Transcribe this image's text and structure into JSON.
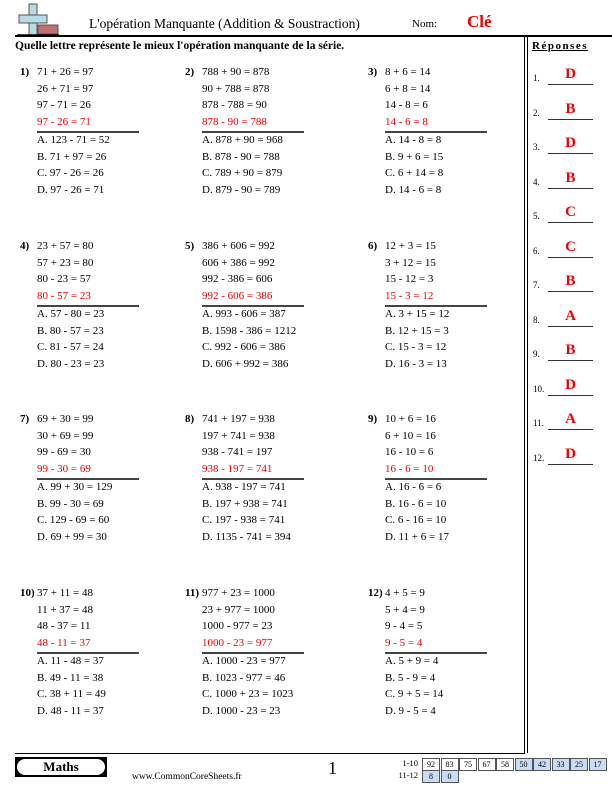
{
  "header": {
    "logo_icon": "plus-minus-icon",
    "title": "L'opération Manquante (Addition & Soustraction)",
    "nom_label": "Nom:",
    "nom_value": "Clé",
    "instruction": "Quelle lettre représente le mieux l'opération manquante de la série."
  },
  "answers": {
    "heading": "Réponses",
    "items": [
      {
        "num": "1.",
        "letter": "D"
      },
      {
        "num": "2.",
        "letter": "B"
      },
      {
        "num": "3.",
        "letter": "D"
      },
      {
        "num": "4.",
        "letter": "B"
      },
      {
        "num": "5.",
        "letter": "C"
      },
      {
        "num": "6.",
        "letter": "C"
      },
      {
        "num": "7.",
        "letter": "B"
      },
      {
        "num": "8.",
        "letter": "A"
      },
      {
        "num": "9.",
        "letter": "B"
      },
      {
        "num": "10.",
        "letter": "D"
      },
      {
        "num": "11.",
        "letter": "A"
      },
      {
        "num": "12.",
        "letter": "D"
      }
    ]
  },
  "problems": [
    {
      "num": "1)",
      "given": [
        "71 + 26 = 97",
        "26 + 71 = 97",
        "97 - 71 = 26"
      ],
      "missing": "97 - 26 = 71",
      "options": [
        "A. 123 - 71 = 52",
        "B. 71 + 97 = 26",
        "C. 97 - 26 = 26",
        "D. 97 - 26 = 71"
      ]
    },
    {
      "num": "2)",
      "given": [
        "788 + 90 = 878",
        "90 + 788 = 878",
        "878 - 788 = 90"
      ],
      "missing": "878 - 90 = 788",
      "options": [
        "A. 878 + 90 = 968",
        "B. 878 - 90 = 788",
        "C. 789 + 90 = 879",
        "D. 879 - 90 = 789"
      ]
    },
    {
      "num": "3)",
      "given": [
        "8 + 6 = 14",
        "6 + 8 = 14",
        "14 - 8 = 6"
      ],
      "missing": "14 - 6 = 8",
      "options": [
        "A. 14 - 8 = 8",
        "B. 9 + 6 = 15",
        "C. 6 + 14 = 8",
        "D. 14 - 6 = 8"
      ]
    },
    {
      "num": "4)",
      "given": [
        "23 + 57 = 80",
        "57 + 23 = 80",
        "80 - 23 = 57"
      ],
      "missing": "80 - 57 = 23",
      "options": [
        "A. 57 - 80 = 23",
        "B. 80 - 57 = 23",
        "C. 81 - 57 = 24",
        "D. 80 - 23 = 23"
      ]
    },
    {
      "num": "5)",
      "given": [
        "386 + 606 = 992",
        "606 + 386 = 992",
        "992 - 386 = 606"
      ],
      "missing": "992 - 606 = 386",
      "options": [
        "A. 993 - 606 = 387",
        "B. 1598 - 386 = 1212",
        "C. 992 - 606 = 386",
        "D. 606 + 992 = 386"
      ]
    },
    {
      "num": "6)",
      "given": [
        "12 + 3 = 15",
        "3 + 12 = 15",
        "15 - 12 = 3"
      ],
      "missing": "15 - 3 = 12",
      "options": [
        "A. 3 + 15 = 12",
        "B. 12 + 15 = 3",
        "C. 15 - 3 = 12",
        "D. 16 - 3 = 13"
      ]
    },
    {
      "num": "7)",
      "given": [
        "69 + 30 = 99",
        "30 + 69 = 99",
        "99 - 69 = 30"
      ],
      "missing": "99 - 30 = 69",
      "options": [
        "A. 99 + 30 = 129",
        "B. 99 - 30 = 69",
        "C. 129 - 69 = 60",
        "D. 69 + 99 = 30"
      ]
    },
    {
      "num": "8)",
      "given": [
        "741 + 197 = 938",
        "197 + 741 = 938",
        "938 - 741 = 197"
      ],
      "missing": "938 - 197 = 741",
      "options": [
        "A. 938 - 197 = 741",
        "B. 197 + 938 = 741",
        "C. 197 - 938 = 741",
        "D. 1135 - 741 = 394"
      ]
    },
    {
      "num": "9)",
      "given": [
        "10 + 6 = 16",
        "6 + 10 = 16",
        "16 - 10 = 6"
      ],
      "missing": "16 - 6 = 10",
      "options": [
        "A. 16 - 6 = 6",
        "B. 16 - 6 = 10",
        "C. 6 - 16 = 10",
        "D. 11 + 6 = 17"
      ]
    },
    {
      "num": "10)",
      "given": [
        "37 + 11 = 48",
        "11 + 37 = 48",
        "48 - 37 = 11"
      ],
      "missing": "48 - 11 = 37",
      "options": [
        "A. 11 - 48 = 37",
        "B. 49 - 11 = 38",
        "C. 38 + 11 = 49",
        "D. 48 - 11 = 37"
      ]
    },
    {
      "num": "11)",
      "given": [
        "977 + 23 = 1000",
        "23 + 977 = 1000",
        "1000 - 977 = 23"
      ],
      "missing": "1000 - 23 = 977",
      "options": [
        "A. 1000 - 23 = 977",
        "B. 1023 - 977 = 46",
        "C. 1000 + 23 = 1023",
        "D. 1000 - 23 = 23"
      ]
    },
    {
      "num": "12)",
      "given": [
        "4 + 5 = 9",
        "5 + 4 = 9",
        "9 - 4 = 5"
      ],
      "missing": "9 - 5 = 4",
      "options": [
        "A. 5 + 9 = 4",
        "B. 5 - 9 = 4",
        "C. 9 + 5 = 14",
        "D. 9 - 5 = 4"
      ]
    }
  ],
  "footer": {
    "subject": "Maths",
    "site": "www.CommonCoreSheets.fr",
    "page": "1",
    "score_rows": [
      {
        "label": "1-10",
        "cells": [
          {
            "v": "92",
            "blue": false
          },
          {
            "v": "83",
            "blue": false
          },
          {
            "v": "75",
            "blue": false
          },
          {
            "v": "67",
            "blue": false
          },
          {
            "v": "58",
            "blue": false
          },
          {
            "v": "50",
            "blue": true
          },
          {
            "v": "42",
            "blue": true
          },
          {
            "v": "33",
            "blue": true
          },
          {
            "v": "25",
            "blue": true
          },
          {
            "v": "17",
            "blue": true
          }
        ]
      },
      {
        "label": "11-12",
        "cells": [
          {
            "v": "8",
            "blue": true
          },
          {
            "v": "0",
            "blue": true
          }
        ]
      }
    ],
    "colors": {
      "score_blue": "#c7dcf7",
      "answer_red": "#e00000"
    }
  }
}
